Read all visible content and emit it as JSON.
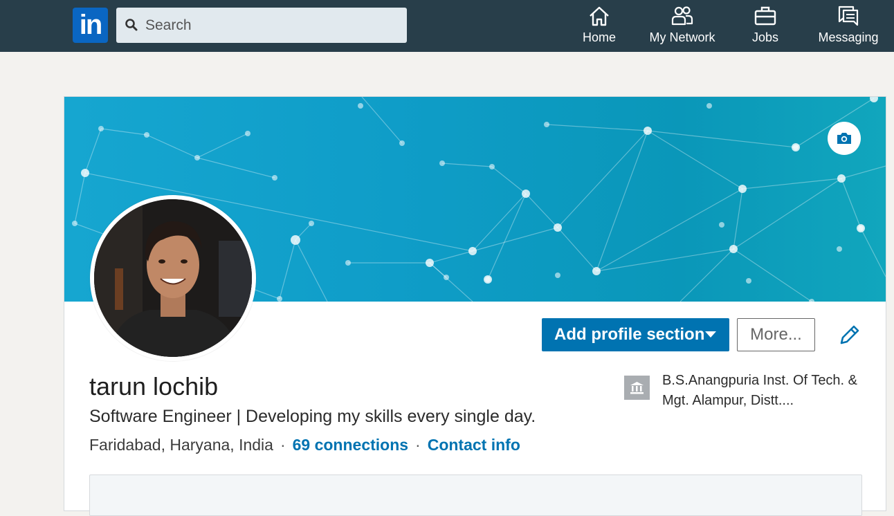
{
  "nav": {
    "logo_text": "in",
    "search_placeholder": "Search",
    "items": [
      {
        "label": "Home",
        "icon": "home-icon"
      },
      {
        "label": "My Network",
        "icon": "network-icon"
      },
      {
        "label": "Jobs",
        "icon": "briefcase-icon"
      },
      {
        "label": "Messaging",
        "icon": "messaging-icon"
      }
    ]
  },
  "profile": {
    "name": "tarun lochib",
    "headline": "Software Engineer | Developing my skills every single day.",
    "location": "Faridabad, Haryana, India",
    "separator": "·",
    "connections": "69 connections",
    "contact": "Contact info",
    "education": "B.S.Anangpuria Inst. Of Tech. & Mgt. Alampur, Distt...."
  },
  "actions": {
    "add_section": "Add profile section",
    "more": "More..."
  },
  "colors": {
    "nav_bg": "#283e4a",
    "brand": "#0073b1",
    "banner": "#0f9dc8",
    "page_bg": "#f3f2ef"
  }
}
